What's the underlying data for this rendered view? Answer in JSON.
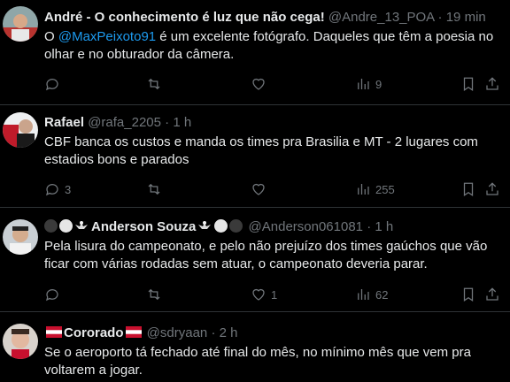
{
  "tweets": [
    {
      "name": "André - O conhecimento é luz que não cega!",
      "handle": "@Andre_13_POA",
      "sep": "·",
      "time": "19 min",
      "text_before": "O ",
      "mention": "@MaxPeixoto91",
      "text_after": " é um excelente fotógrafo. Daqueles que têm a poesia no olhar e no obturador da câmera.",
      "replies": "",
      "retweets": "",
      "likes": "",
      "views": "9"
    },
    {
      "name": "Rafael",
      "handle": "@rafa_2205",
      "sep": "·",
      "time": "1 h",
      "text": "CBF banca os custos e manda os times pra Brasilia e MT - 2 lugares com estadios bons e parados",
      "replies": "3",
      "retweets": "",
      "likes": "",
      "views": "255"
    },
    {
      "name": "Anderson Souza",
      "handle": "@Anderson061081",
      "sep": "·",
      "time": "1 h",
      "text": "Pela lisura do campeonato, e pelo não prejuízo dos times gaúchos que vão ficar com várias rodadas sem atuar, o campeonato deveria parar.",
      "replies": "",
      "retweets": "",
      "likes": "1",
      "views": "62"
    },
    {
      "name": "Cororado",
      "handle": "@sdryaan",
      "sep": "·",
      "time": "2 h",
      "text": "Se o aeroporto tá fechado até final do mês, no mínimo mês que vem pra voltarem a jogar."
    }
  ],
  "icons": {
    "reply": "reply-icon",
    "retweet": "retweet-icon",
    "like": "like-icon",
    "views": "views-icon",
    "bookmark": "bookmark-icon",
    "share": "share-icon"
  },
  "colors": {
    "background": "#000000",
    "text": "#e7e9ea",
    "secondary": "#71767b",
    "link": "#1d9bf0",
    "divider": "#2f3336"
  }
}
